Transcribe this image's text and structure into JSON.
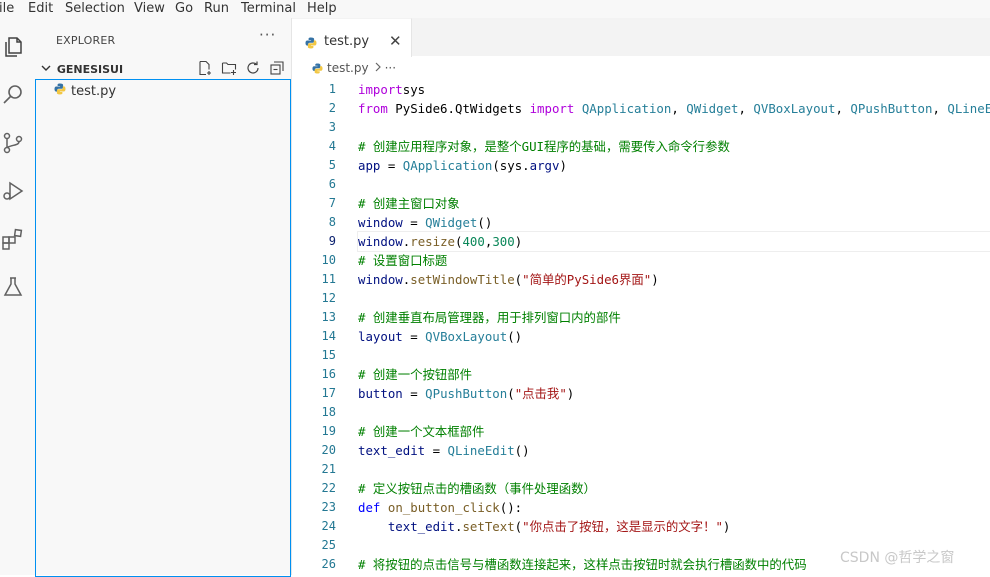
{
  "menu": [
    "ile",
    "Edit",
    "Selection",
    "View",
    "Go",
    "Run",
    "Terminal",
    "Help"
  ],
  "activity_icons": [
    "files-icon",
    "search-icon",
    "source-control-icon",
    "run-debug-icon",
    "extensions-icon",
    "testing-icon"
  ],
  "sidebar": {
    "title": "EXPLORER",
    "more": "···",
    "folder": "GENESISUI",
    "files": [
      {
        "name": "test.py"
      }
    ]
  },
  "tab": {
    "label": "test.py",
    "close": "✕"
  },
  "breadcrumb": {
    "file": "test.py",
    "rest": "···"
  },
  "editor": {
    "active_line": 9,
    "lines": [
      [
        [
          "kw2",
          "import"
        ],
        [
          "",
          "sys"
        ]
      ],
      [
        [
          "kw2",
          "from"
        ],
        [
          "",
          " PySide6.QtWidgets "
        ],
        [
          "kw2",
          "import"
        ],
        [
          "",
          " "
        ],
        [
          "cls",
          "QApplication"
        ],
        [
          "",
          ", "
        ],
        [
          "cls",
          "QWidget"
        ],
        [
          "",
          ", "
        ],
        [
          "cls",
          "QVBoxLayout"
        ],
        [
          "",
          ", "
        ],
        [
          "cls",
          "QPushButton"
        ],
        [
          "",
          ", "
        ],
        [
          "cls",
          "QLineEdit"
        ]
      ],
      [],
      [
        [
          "cm",
          "# 创建应用程序对象，是整个GUI程序的基础，需要传入命令行参数"
        ]
      ],
      [
        [
          "vr",
          "app"
        ],
        [
          "",
          " = "
        ],
        [
          "cls",
          "QApplication"
        ],
        [
          "",
          "(sys."
        ],
        [
          "vr",
          "argv"
        ],
        [
          "",
          ")"
        ]
      ],
      [],
      [
        [
          "cm",
          "# 创建主窗口对象"
        ]
      ],
      [
        [
          "vr",
          "window"
        ],
        [
          "",
          " = "
        ],
        [
          "cls",
          "QWidget"
        ],
        [
          "",
          "()"
        ]
      ],
      [
        [
          "vr",
          "window"
        ],
        [
          "",
          "."
        ],
        [
          "fn",
          "resize"
        ],
        [
          "",
          "("
        ],
        [
          "nm",
          "400"
        ],
        [
          "",
          ","
        ],
        [
          "nm",
          "300"
        ],
        [
          "",
          ")"
        ]
      ],
      [
        [
          "cm",
          "# 设置窗口标题"
        ]
      ],
      [
        [
          "vr",
          "window"
        ],
        [
          "",
          "."
        ],
        [
          "fn",
          "setWindowTitle"
        ],
        [
          "",
          "("
        ],
        [
          "st",
          "\"简单的PySide6界面\""
        ],
        [
          "",
          ")"
        ]
      ],
      [],
      [
        [
          "cm",
          "# 创建垂直布局管理器，用于排列窗口内的部件"
        ]
      ],
      [
        [
          "vr",
          "layout"
        ],
        [
          "",
          " = "
        ],
        [
          "cls",
          "QVBoxLayout"
        ],
        [
          "",
          "()"
        ]
      ],
      [],
      [
        [
          "cm",
          "# 创建一个按钮部件"
        ]
      ],
      [
        [
          "vr",
          "button"
        ],
        [
          "",
          " = "
        ],
        [
          "cls",
          "QPushButton"
        ],
        [
          "",
          "("
        ],
        [
          "st",
          "\"点击我\""
        ],
        [
          "",
          ")"
        ]
      ],
      [],
      [
        [
          "cm",
          "# 创建一个文本框部件"
        ]
      ],
      [
        [
          "vr",
          "text_edit"
        ],
        [
          "",
          " = "
        ],
        [
          "cls",
          "QLineEdit"
        ],
        [
          "",
          "()"
        ]
      ],
      [],
      [
        [
          "cm",
          "# 定义按钮点击的槽函数（事件处理函数）"
        ]
      ],
      [
        [
          "kw",
          "def"
        ],
        [
          "",
          " "
        ],
        [
          "fn",
          "on_button_click"
        ],
        [
          "",
          "():"
        ]
      ],
      [
        [
          "",
          "    "
        ],
        [
          "vr",
          "text_edit"
        ],
        [
          "",
          "."
        ],
        [
          "fn",
          "setText"
        ],
        [
          "",
          "("
        ],
        [
          "st",
          "\"你点击了按钮，这是显示的文字！\""
        ],
        [
          "",
          ")"
        ]
      ],
      [],
      [
        [
          "cm",
          "# 将按钮的点击信号与槽函数连接起来，这样点击按钮时就会执行槽函数中的代码"
        ]
      ]
    ]
  },
  "watermark": "CSDN @哲学之窗"
}
